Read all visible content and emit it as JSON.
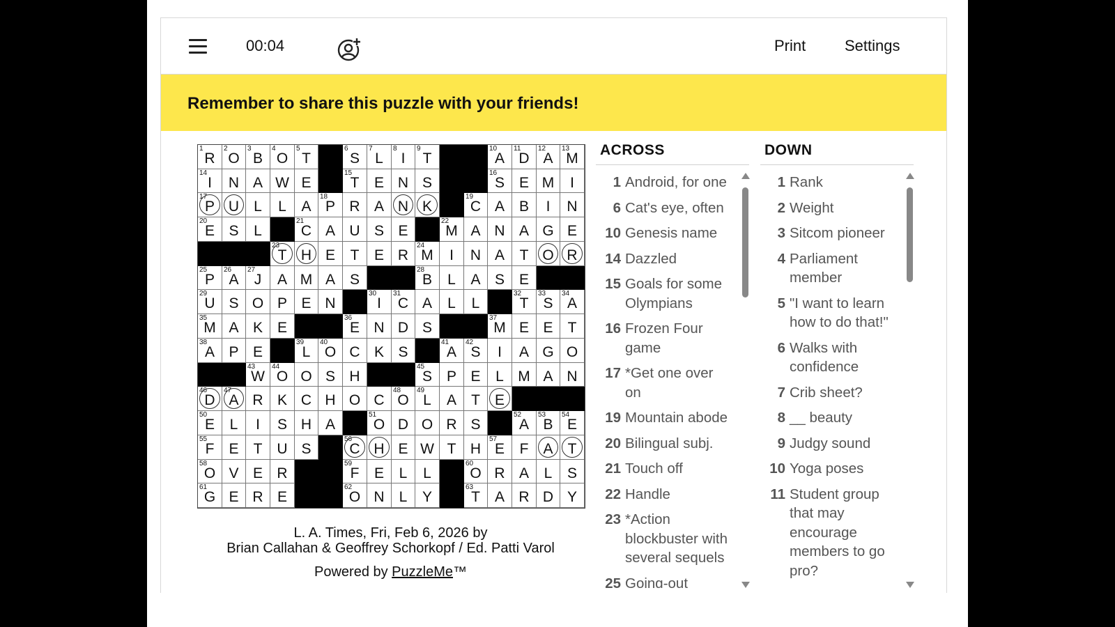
{
  "toolbar": {
    "menu_icon": "hamburger-menu-icon",
    "timer": "00:04",
    "invite_icon": "invite-friend-icon",
    "print_label": "Print",
    "settings_label": "Settings"
  },
  "banner": {
    "text": "Remember to share this puzzle with your friends!",
    "color": "#fde74c"
  },
  "grid": {
    "rows": [
      "ROBOT#SLIT##ADAM",
      "INAWE#TENS##SEMI",
      "PULLAPRANK#CABIN",
      "ESL#CAUSE#MANAGE",
      "###THETERMINATOR",
      "PAJAMAS##BLASE##",
      "USOPEN#ICALL#TSA",
      "MAKE##ENDS##MEET",
      "APE#LOCKS#ASIAGO",
      "##WOOSH##SPELMAN",
      "DARKCHOCOLATE###",
      "ELISHA#ODORS#ABE",
      "FETUS#CHEWTHEFAT",
      "OVER##FELL#ORALS",
      "GERE##ONLY#TARDY"
    ],
    "numbers": [
      [
        1,
        2,
        3,
        4,
        5,
        0,
        6,
        7,
        8,
        9,
        0,
        0,
        10,
        11,
        12,
        13
      ],
      [
        14,
        0,
        0,
        0,
        0,
        0,
        15,
        0,
        0,
        0,
        0,
        0,
        16,
        0,
        0,
        0
      ],
      [
        17,
        0,
        0,
        0,
        0,
        18,
        0,
        0,
        0,
        0,
        0,
        19,
        0,
        0,
        0,
        0
      ],
      [
        20,
        0,
        0,
        0,
        21,
        0,
        0,
        0,
        0,
        0,
        22,
        0,
        0,
        0,
        0,
        0
      ],
      [
        0,
        0,
        0,
        23,
        0,
        0,
        0,
        0,
        0,
        24,
        0,
        0,
        0,
        0,
        0,
        0
      ],
      [
        25,
        26,
        27,
        0,
        0,
        0,
        0,
        0,
        0,
        28,
        0,
        0,
        0,
        0,
        0,
        0
      ],
      [
        29,
        0,
        0,
        0,
        0,
        0,
        0,
        30,
        31,
        0,
        0,
        0,
        0,
        32,
        33,
        34
      ],
      [
        35,
        0,
        0,
        0,
        0,
        0,
        36,
        0,
        0,
        0,
        0,
        0,
        37,
        0,
        0,
        0
      ],
      [
        38,
        0,
        0,
        0,
        39,
        40,
        0,
        0,
        0,
        0,
        41,
        42,
        0,
        0,
        0,
        0
      ],
      [
        0,
        0,
        43,
        44,
        0,
        0,
        0,
        0,
        0,
        45,
        0,
        0,
        0,
        0,
        0,
        0
      ],
      [
        46,
        47,
        0,
        0,
        0,
        0,
        0,
        0,
        48,
        49,
        0,
        0,
        0,
        0,
        0,
        0
      ],
      [
        50,
        0,
        0,
        0,
        0,
        0,
        0,
        51,
        0,
        0,
        0,
        0,
        0,
        52,
        53,
        54
      ],
      [
        55,
        0,
        0,
        0,
        0,
        0,
        56,
        0,
        0,
        0,
        0,
        0,
        57,
        0,
        0,
        0
      ],
      [
        58,
        0,
        0,
        0,
        0,
        0,
        59,
        0,
        0,
        0,
        0,
        60,
        0,
        0,
        0,
        0
      ],
      [
        61,
        0,
        0,
        0,
        0,
        0,
        62,
        0,
        0,
        0,
        0,
        63,
        0,
        0,
        0,
        0
      ]
    ],
    "circled": [
      [
        2,
        0
      ],
      [
        2,
        1
      ],
      [
        2,
        8
      ],
      [
        2,
        9
      ],
      [
        4,
        3
      ],
      [
        4,
        4
      ],
      [
        4,
        14
      ],
      [
        4,
        15
      ],
      [
        10,
        0
      ],
      [
        10,
        1
      ],
      [
        10,
        12
      ],
      [
        10,
        13
      ],
      [
        12,
        6
      ],
      [
        12,
        7
      ],
      [
        12,
        14
      ],
      [
        12,
        15
      ]
    ]
  },
  "credits": {
    "line1": "L. A. Times, Fri, Feb 6, 2026 by",
    "line2": "Brian Callahan & Geoffrey Schorkopf / Ed. Patti Varol",
    "powered_prefix": "Powered by ",
    "powered_link": "PuzzleMe",
    "powered_suffix": "™"
  },
  "across": {
    "heading": "ACROSS",
    "clues": [
      {
        "num": "1",
        "text": "Android, for one"
      },
      {
        "num": "6",
        "text": "Cat's eye, often"
      },
      {
        "num": "10",
        "text": "Genesis name"
      },
      {
        "num": "14",
        "text": "Dazzled"
      },
      {
        "num": "15",
        "text": "Goals for some Olympians"
      },
      {
        "num": "16",
        "text": "Frozen Four game"
      },
      {
        "num": "17",
        "text": "*Get one over on"
      },
      {
        "num": "19",
        "text": "Mountain abode"
      },
      {
        "num": "20",
        "text": "Bilingual subj."
      },
      {
        "num": "21",
        "text": "Touch off"
      },
      {
        "num": "22",
        "text": "Handle"
      },
      {
        "num": "23",
        "text": "*Action blockbuster with several sequels"
      },
      {
        "num": "25",
        "text": "Going-out"
      }
    ]
  },
  "down": {
    "heading": "DOWN",
    "clues": [
      {
        "num": "1",
        "text": "Rank"
      },
      {
        "num": "2",
        "text": "Weight"
      },
      {
        "num": "3",
        "text": "Sitcom pioneer"
      },
      {
        "num": "4",
        "text": "Parliament member"
      },
      {
        "num": "5",
        "text": "\"I want to learn how to do that!\""
      },
      {
        "num": "6",
        "text": "Walks with confidence"
      },
      {
        "num": "7",
        "text": "Crib sheet?"
      },
      {
        "num": "8",
        "text": "__ beauty"
      },
      {
        "num": "9",
        "text": "Judgy sound"
      },
      {
        "num": "10",
        "text": "Yoga poses"
      },
      {
        "num": "11",
        "text": "Student group that may encourage members to go pro?"
      }
    ]
  }
}
